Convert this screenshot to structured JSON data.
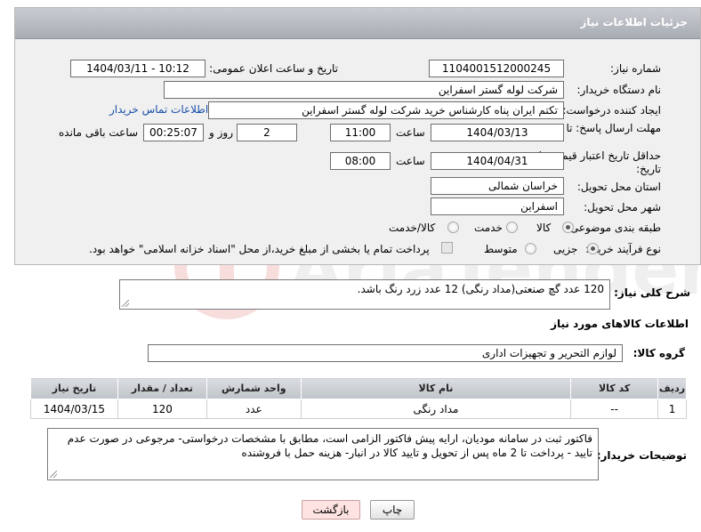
{
  "header": {
    "title": "جزئیات اطلاعات نیاز"
  },
  "form": {
    "need_number_label": "شماره نیاز:",
    "need_number": "1104001512000245",
    "announce_label": "تاریخ و ساعت اعلان عمومی:",
    "announce_value": "1404/03/11 - 10:12",
    "buyer_org_label": "نام دستگاه خریدار:",
    "buyer_org": "شرکت لوله گستر اسفراین",
    "creator_label": "ایجاد کننده درخواست:",
    "creator": "تکتم ایران پناه کارشناس خرید شرکت لوله گستر اسفراین",
    "contact_link": "اطلاعات تماس خریدار",
    "deadline_label": "مهلت ارسال پاسخ: تا تاریخ:",
    "deadline_date": "1404/03/13",
    "time_word": "ساعت",
    "deadline_time": "11:00",
    "days": "2",
    "day_and": "روز و",
    "remaining_time": "00:25:07",
    "remaining_label": "ساعت باقی مانده",
    "price_validity_label": "حداقل تاریخ اعتبار قیمت: تا تاریخ:",
    "price_validity_date": "1404/04/31",
    "price_validity_time": "08:00",
    "province_label": "استان محل تحویل:",
    "province": "خراسان شمالی",
    "city_label": "شهر محل تحویل:",
    "city": "اسفراین",
    "category_label": "طبقه بندی موضوعی:",
    "category_options": [
      "کالا",
      "خدمت",
      "کالا/خدمت"
    ],
    "category_selected": "کالا",
    "process_label": "نوع فرآیند خرید :",
    "process_options": [
      "جزیی",
      "متوسط"
    ],
    "process_selected": "جزیی",
    "payment_note": "پرداخت تمام یا بخشی از مبلغ خرید،از محل \"اسناد خزانه اسلامی\" خواهد بود."
  },
  "description": {
    "label": "شرح کلی نیاز:",
    "text": "120 عدد گچ صنعتی(مداد رنگی) 12 عدد زرد رنگ باشد."
  },
  "goods": {
    "section_title": "اطلاعات کالاهای مورد نیاز",
    "group_label": "گروه کالا:",
    "group_value": "لوازم التحریر و تجهیزات اداری",
    "columns": [
      "ردیف",
      "کد کالا",
      "نام کالا",
      "واحد شمارش",
      "تعداد / مقدار",
      "تاریخ نیاز"
    ],
    "rows": [
      [
        "1",
        "--",
        "مداد رنگی",
        "عدد",
        "120",
        "1404/03/15"
      ]
    ]
  },
  "buyer_notes": {
    "label": "توضیحات خریدار:",
    "text": "فاکتور ثبت در سامانه مودیان، ارایه پیش فاکتور الزامی است، مطابق با مشخصات درخواستی- مرجوعی در صورت عدم تایید - پرداخت تا 2 ماه پس از تحویل و تایید کالا در انبار- هزینه حمل با فروشنده"
  },
  "buttons": {
    "print": "چاپ",
    "back": "بازگشت"
  },
  "colors": {
    "header_bg": "#b3b8bf",
    "link": "#1b4fa8",
    "back_btn_bg": "#ffe3e3"
  }
}
